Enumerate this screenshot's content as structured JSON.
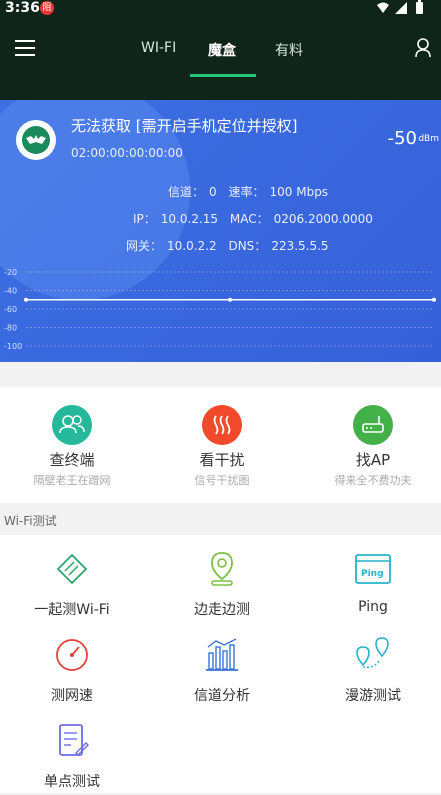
{
  "status_bar": {
    "time": "3:36",
    "badge": "阻"
  },
  "tabs": [
    {
      "label": "WI-FI"
    },
    {
      "label": "魔盒"
    },
    {
      "label": "有料"
    }
  ],
  "wifi": {
    "ssid": "无法获取 [需开启手机定位并授权]",
    "bssid": "02:00:00:00:00:00",
    "signal": "-50",
    "signal_unit": "dBm",
    "channel_label": "信道：",
    "channel_value": "0",
    "rate_label": "速率：",
    "rate_value": "100 Mbps",
    "ip_label": "IP：",
    "ip_value": "10.0.2.15",
    "mac_label": "MAC：",
    "mac_value": "0206.2000.0000",
    "gateway_label": "网关：",
    "gateway_value": "10.0.2.2",
    "dns_label": "DNS：",
    "dns_value": "223.5.5.5"
  },
  "signal_chart": {
    "y_ticks": [
      "-20",
      "-40",
      "-60",
      "-80",
      "-100"
    ],
    "values": [
      -50,
      -50,
      -50
    ]
  },
  "quick_actions": [
    {
      "label": "查终端",
      "sub": "隔壁老王在蹭网",
      "icon": "people-icon",
      "color": "#25b89a"
    },
    {
      "label": "看干扰",
      "sub": "信号干扰图",
      "icon": "heat-waves-icon",
      "color": "#f04a2a"
    },
    {
      "label": "找AP",
      "sub": "得来全不费功夫",
      "icon": "router-icon",
      "color": "#43b04a"
    }
  ],
  "section_title": "Wi-Fi测试",
  "tests": [
    {
      "label": "一起测Wi-Fi",
      "icon": "tag-icon"
    },
    {
      "label": "边走边测",
      "icon": "location-pin-icon"
    },
    {
      "label": "Ping",
      "icon": "ping-window-icon"
    },
    {
      "label": "测网速",
      "icon": "speedometer-icon"
    },
    {
      "label": "信道分析",
      "icon": "bar-chart-icon"
    },
    {
      "label": "漫游测试",
      "icon": "roaming-pins-icon"
    },
    {
      "label": "单点测试",
      "icon": "document-edit-icon"
    }
  ]
}
